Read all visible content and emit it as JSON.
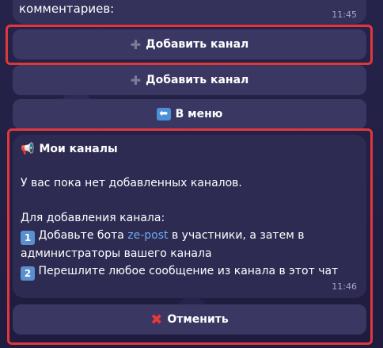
{
  "previous_message": {
    "text_tail": "комментариев:",
    "time": "11:45"
  },
  "keyboard_top": [
    {
      "label": "Добавить канал",
      "icon": "plus-icon"
    },
    {
      "label": "Добавить канал",
      "icon": "plus-icon"
    },
    {
      "label": "В меню",
      "icon": "back-arrow-icon"
    }
  ],
  "message": {
    "title": "Мои каналы",
    "title_icon": "megaphone-icon",
    "empty_text": "У вас пока нет добавленных каналов.",
    "howto_header": "Для добавления канала:",
    "step1_badge": "1",
    "step1_prefix": "Добавьте бота",
    "step1_link": "ze-post",
    "step1_suffix": "в участники, а затем в администраторы вашего канала",
    "step2_badge": "2",
    "step2_text": "Перешлите любое сообщение из канала в этот чат",
    "time": "11:46"
  },
  "keyboard_bottom": {
    "cancel_label": "Отменить",
    "cancel_icon": "cross-icon"
  },
  "colors": {
    "highlight": "#e0383a",
    "link": "#6eaaf2",
    "button_bg": "#3a3763"
  }
}
